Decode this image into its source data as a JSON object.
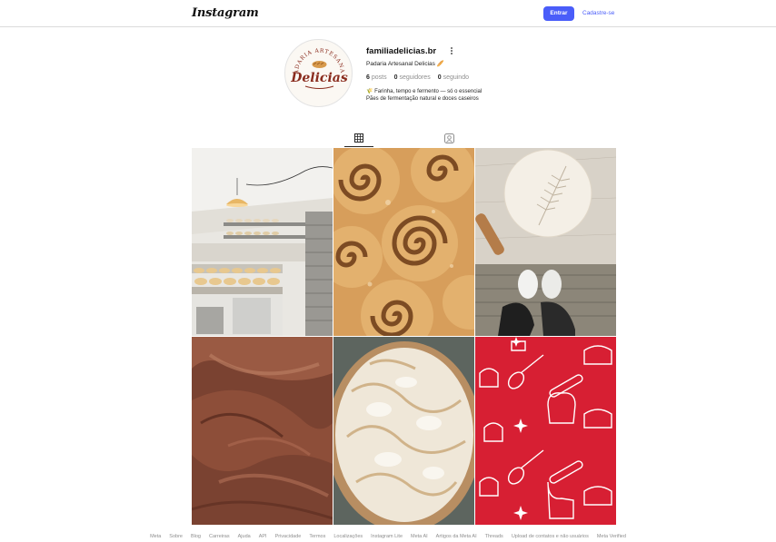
{
  "header": {
    "logo_text": "Instagram",
    "login_label": "Entrar",
    "signup_label": "Cadastre-se",
    "accent_color": "#4a5df9"
  },
  "profile": {
    "avatar": {
      "brand_top": "PADARIA ARTESANAL",
      "brand_name": "Delicias"
    },
    "username": "familiadelicias.br",
    "full_name": "Padaria Artesanal Delicias 🥖",
    "stats": {
      "posts_count": "6",
      "posts_label": "posts",
      "followers_count": "0",
      "followers_label": "seguidores",
      "following_count": "0",
      "following_label": "seguindo"
    },
    "bio_line1": "🌾 Farinha, tempo e fermento — só o essencial",
    "bio_line2": "Pães de fermentação natural e doces caseiros"
  },
  "tabs": [
    {
      "icon": "grid-icon",
      "active": true
    },
    {
      "icon": "tagged-user-icon",
      "active": false
    }
  ],
  "posts": [
    {
      "subject": "bakery-kitchen-photo"
    },
    {
      "subject": "cinnamon-rolls-photo"
    },
    {
      "subject": "scored-dough-photo"
    },
    {
      "subject": "chocolate-frosting-photo"
    },
    {
      "subject": "meringue-pie-photo"
    },
    {
      "subject": "red-baking-pattern"
    }
  ],
  "footer": {
    "links": [
      "Meta",
      "Sobre",
      "Blog",
      "Carreiras",
      "Ajuda",
      "API",
      "Privacidade",
      "Termos",
      "Localizações",
      "Instagram Lite",
      "Meta AI",
      "Artigos da Meta AI",
      "Threads",
      "Upload de contatos e não usuários",
      "Meta Verified"
    ]
  }
}
